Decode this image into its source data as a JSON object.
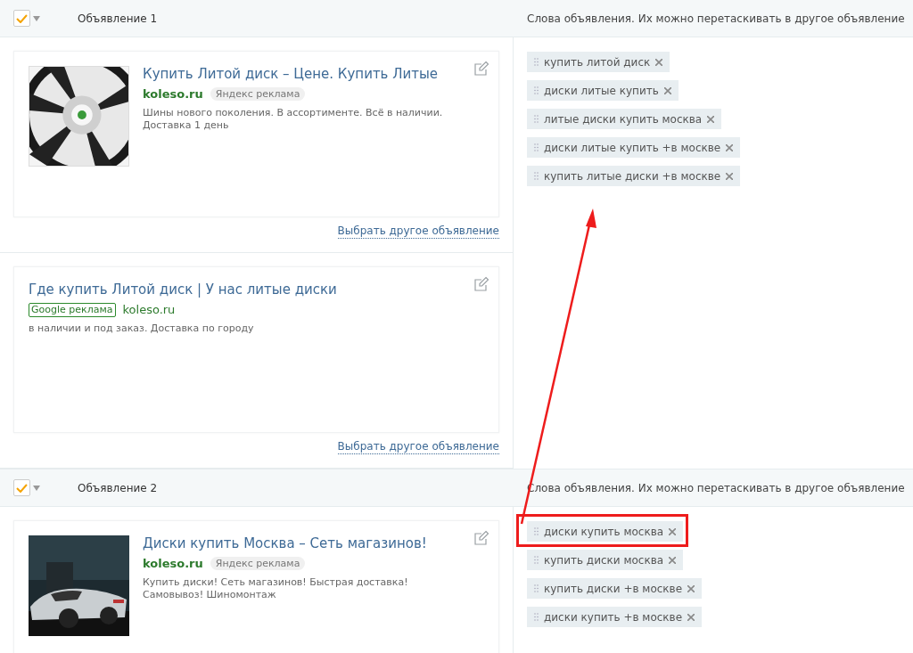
{
  "groups": [
    {
      "checked": true,
      "title": "Объявление 1",
      "keywords_title": "Слова объявления. Их можно перетаскивать в другое объявление",
      "ads": [
        {
          "title": "Купить Литой диск – Цене. Купить Литые",
          "domain": "koleso.ru",
          "badge": {
            "label": "Яндекс реклама",
            "kind": "yandex"
          },
          "description": "Шины нового поколения. В ассортименте. Всё в наличии. Доставка 1 день",
          "link": "Выбрать другое объявление"
        },
        {
          "title": "Где купить Литой диск | У нас литые диски",
          "domain": "koleso.ru",
          "badge": {
            "label": "Google реклама",
            "kind": "google"
          },
          "description": "в наличии и под заказ. Доставка по городу",
          "link": "Выбрать другое объявление"
        }
      ],
      "keywords": [
        {
          "text": "купить литой диск",
          "highlighted": false
        },
        {
          "text": "диски литые купить",
          "highlighted": false
        },
        {
          "text": "литые диски купить москва",
          "highlighted": false
        },
        {
          "text": "диски литые купить +в москве",
          "highlighted": false
        },
        {
          "text": "купить литые диски +в москве",
          "highlighted": false
        }
      ]
    },
    {
      "checked": true,
      "title": "Объявление 2",
      "keywords_title": "Слова объявления. Их можно перетаскивать в другое объявление",
      "ads": [
        {
          "title": "Диски купить Москва – Сеть магазинов!",
          "domain": "koleso.ru",
          "badge": {
            "label": "Яндекс реклама",
            "kind": "yandex"
          },
          "description": "Купить диски! Сеть магазинов! Быстрая доставка! Самовывоз! Шиномонтаж"
        }
      ],
      "keywords": [
        {
          "text": "диски купить москва",
          "highlighted": true
        },
        {
          "text": "купить диски москва",
          "highlighted": false
        },
        {
          "text": "купить диски +в москве",
          "highlighted": false
        },
        {
          "text": "диски купить +в москве",
          "highlighted": false
        }
      ]
    }
  ]
}
